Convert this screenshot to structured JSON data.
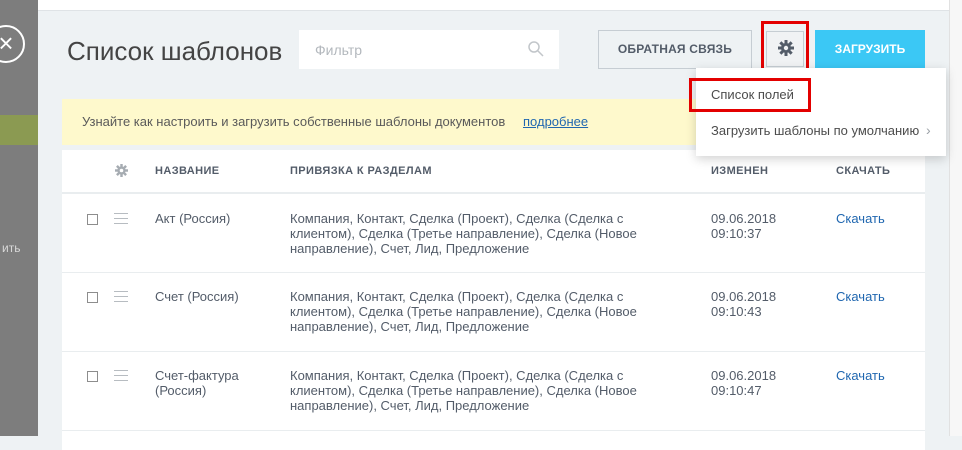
{
  "backdrop": {
    "side_label": "ить",
    "close_glyph": "×"
  },
  "header": {
    "title": "Список шаблонов",
    "filter_placeholder": "Фильтр",
    "feedback_label": "ОБРАТНАЯ СВЯЗЬ",
    "upload_label": "ЗАГРУЗИТЬ"
  },
  "banner": {
    "text": "Узнайте как настроить и загрузить собственные шаблоны документов",
    "link": "подробнее"
  },
  "menu": {
    "items": [
      {
        "label": "Список полей"
      },
      {
        "label": "Загрузить шаблоны по умолчанию"
      }
    ],
    "chevron": "›"
  },
  "table": {
    "columns": {
      "name": "НАЗВАНИЕ",
      "binding": "ПРИВЯЗКА К РАЗДЕЛАМ",
      "modified": "ИЗМЕНЕН",
      "download": "СКАЧАТЬ"
    },
    "rows": [
      {
        "name": "Акт (Россия)",
        "binding_lines": [
          "Компания, Контакт, Сделка (Проект), Сделка (Сделка с",
          "клиентом), Сделка (Третье направление), Сделка (Новое",
          "направление), Счет, Лид, Предложение"
        ],
        "date": "09.06.2018",
        "time": "09:10:37",
        "download": "Скачать"
      },
      {
        "name": "Счет (Россия)",
        "binding_lines": [
          "Компания, Контакт, Сделка (Проект), Сделка (Сделка с",
          "клиентом), Сделка (Третье направление), Сделка (Новое",
          "направление), Счет, Лид, Предложение"
        ],
        "date": "09.06.2018",
        "time": "09:10:43",
        "download": "Скачать"
      },
      {
        "name_lines": [
          "Счет-фактура",
          "(Россия)"
        ],
        "binding_lines": [
          "Компания, Контакт, Сделка (Проект), Сделка (Сделка с",
          "клиентом), Сделка (Третье направление), Сделка (Новое",
          "направление), Счет, Лид, Предложение"
        ],
        "date": "09.06.2018",
        "time": "09:10:47",
        "download": "Скачать"
      }
    ]
  },
  "colors": {
    "accent": "#3bc8f5",
    "highlight": "#e30000",
    "banner_bg": "#fef9cc",
    "link": "#2067b0"
  }
}
